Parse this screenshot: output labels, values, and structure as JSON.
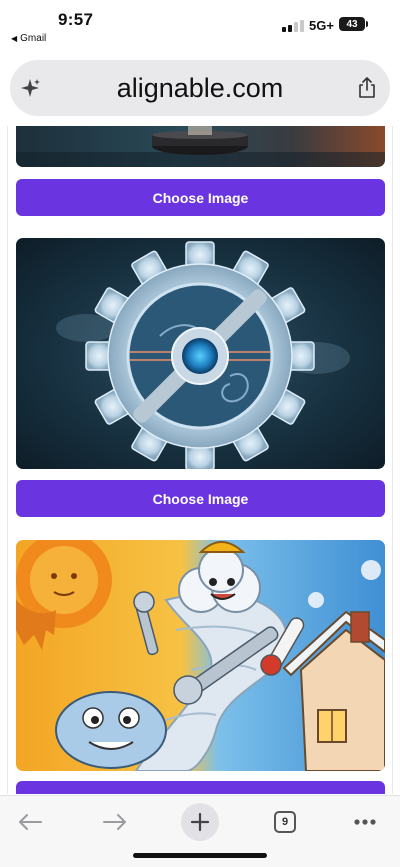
{
  "status_bar": {
    "time": "9:57",
    "back_app": "Gmail",
    "network": "5G+",
    "battery": "43"
  },
  "url_bar": {
    "url": "alignable.com",
    "left_icon": "sparkle-icon",
    "right_icon": "share-icon"
  },
  "cards": [
    {
      "image": "dark-product-photo",
      "button_label": "Choose Image"
    },
    {
      "image": "frosted-gear-illustration",
      "button_label": "Choose Image"
    },
    {
      "image": "cartoon-hvac-tornado-illustration",
      "button_label": "Choose Image"
    }
  ],
  "toolbar": {
    "back_icon": "arrow-left-icon",
    "forward_icon": "arrow-right-icon",
    "new_tab_icon": "plus-icon",
    "tab_count": "9",
    "menu_icon": "more-icon"
  },
  "colors": {
    "button": "#6a35e0",
    "url_bar_bg": "#e9e9ec"
  }
}
